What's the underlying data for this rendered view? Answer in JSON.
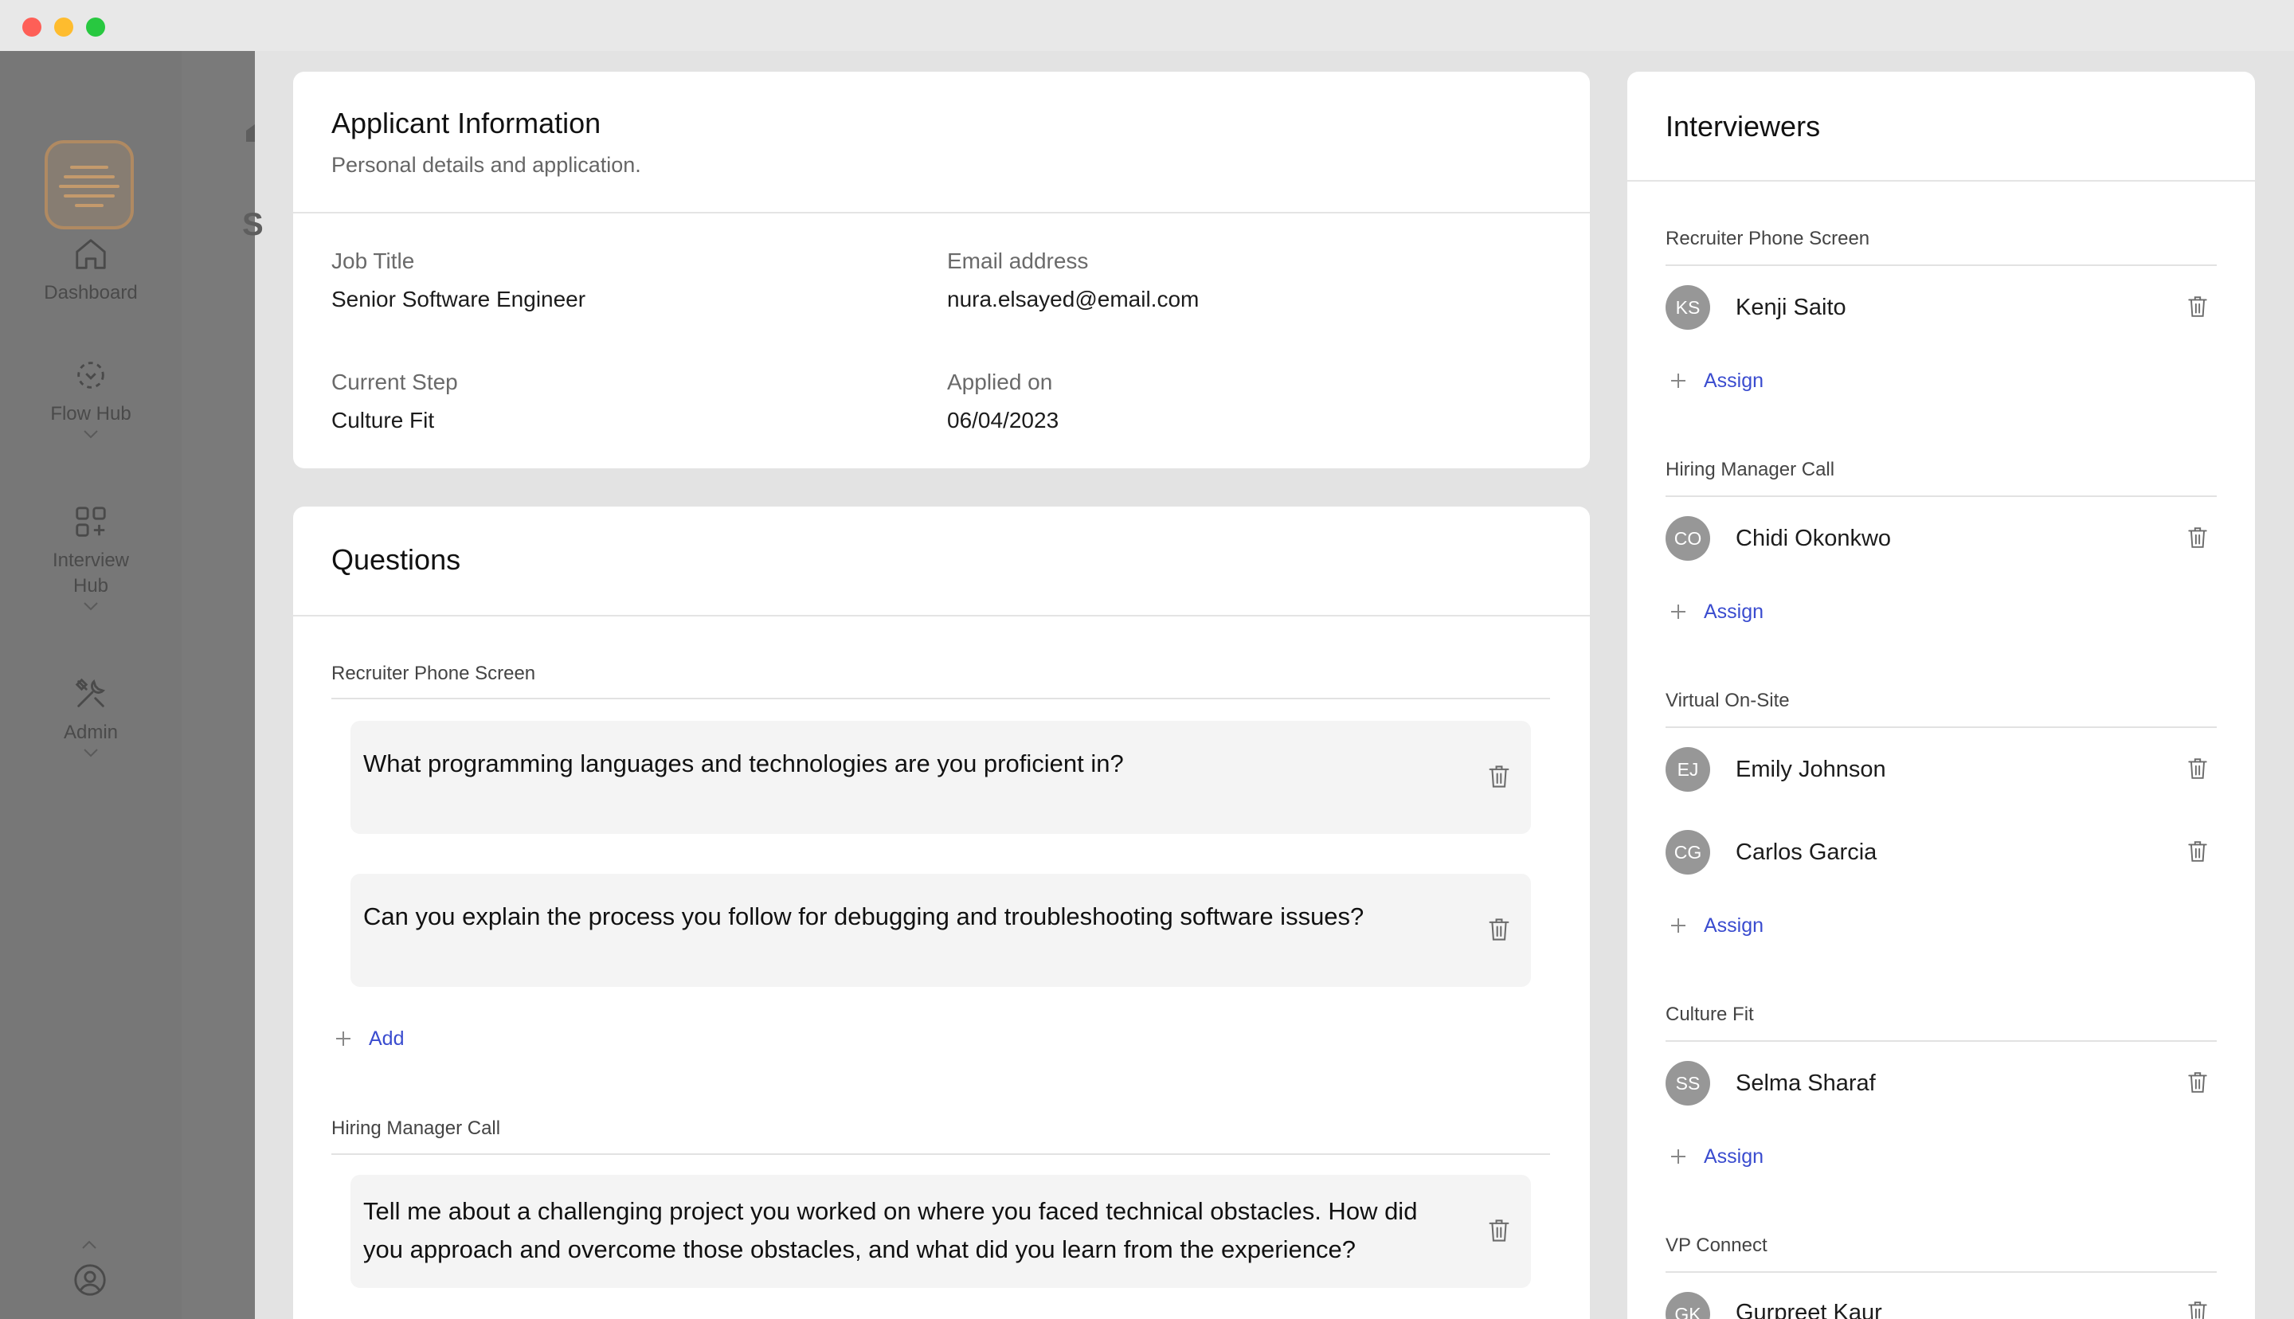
{
  "nav": {
    "items": [
      {
        "label": "Dashboard",
        "icon": "home-icon"
      },
      {
        "label": "Flow Hub",
        "icon": "flow-icon"
      },
      {
        "label": "Interview Hub",
        "icon": "grid-plus-icon"
      },
      {
        "label": "Admin",
        "icon": "tools-icon"
      }
    ]
  },
  "applicant": {
    "title": "Applicant Information",
    "subtitle": "Personal details and application.",
    "job_title_label": "Job Title",
    "job_title": "Senior Software Engineer",
    "email_label": "Email address",
    "email": "nura.elsayed@email.com",
    "step_label": "Current Step",
    "step": "Culture Fit",
    "applied_label": "Applied on",
    "applied": "06/04/2023"
  },
  "questions": {
    "title": "Questions",
    "add_label": "Add",
    "sections": [
      {
        "name": "Recruiter Phone Screen",
        "items": [
          "What programming languages and technologies are you proficient in?",
          "Can you explain the process you follow for debugging and troubleshooting software issues?"
        ]
      },
      {
        "name": "Hiring Manager Call",
        "items": [
          "Tell me about a challenging project you worked on where you faced technical obstacles. How did you approach and overcome those obstacles, and what did you learn from the experience?"
        ]
      }
    ]
  },
  "interviewers": {
    "title": "Interviewers",
    "assign_label": "Assign",
    "sections": [
      {
        "name": "Recruiter Phone Screen",
        "people": [
          {
            "initials": "KS",
            "name": "Kenji Saito"
          }
        ]
      },
      {
        "name": "Hiring Manager Call",
        "people": [
          {
            "initials": "CO",
            "name": "Chidi Okonkwo"
          }
        ]
      },
      {
        "name": "Virtual On-Site",
        "people": [
          {
            "initials": "EJ",
            "name": "Emily Johnson"
          },
          {
            "initials": "CG",
            "name": "Carlos Garcia"
          }
        ]
      },
      {
        "name": "Culture Fit",
        "people": [
          {
            "initials": "SS",
            "name": "Selma Sharaf"
          }
        ]
      },
      {
        "name": "VP Connect",
        "people": [
          {
            "initials": "GK",
            "name": "Gurpreet Kaur"
          }
        ]
      }
    ]
  },
  "colors": {
    "link": "#3a4ccf",
    "avatar": "#979797",
    "overlay": "#777777"
  }
}
